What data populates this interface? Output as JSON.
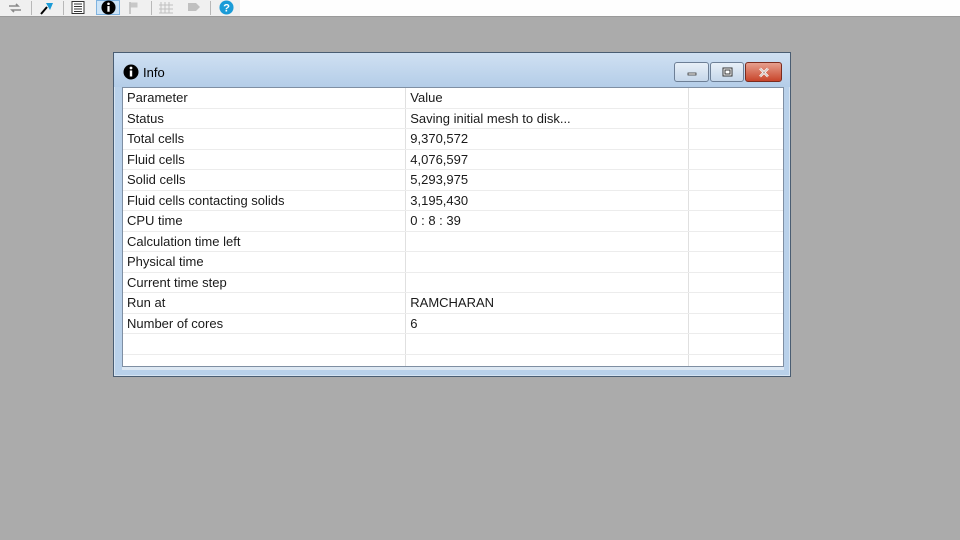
{
  "toolbar": {
    "icons": [
      "swap-arrows-icon",
      "pin-tool-icon",
      "list-icon",
      "info-icon",
      "flag-icon",
      "grid-icon",
      "shape-icon",
      "help-icon"
    ],
    "accent": "#1a9bd7"
  },
  "window": {
    "title": "Info",
    "title_icon": "info-icon",
    "controls": [
      "minimize-icon",
      "maximize-icon",
      "close-icon"
    ]
  },
  "table": {
    "headers": [
      "Parameter",
      "Value",
      ""
    ],
    "rows": [
      [
        "Status",
        "Saving initial mesh to disk..."
      ],
      [
        "Total cells",
        "9,370,572"
      ],
      [
        "Fluid cells",
        "4,076,597"
      ],
      [
        "Solid cells",
        "5,293,975"
      ],
      [
        "Fluid cells contacting solids",
        "3,195,430"
      ],
      [
        "CPU time",
        "0 : 8 : 39"
      ],
      [
        "Calculation time left",
        ""
      ],
      [
        "Physical time",
        ""
      ],
      [
        "Current time step",
        ""
      ],
      [
        "Run at",
        "RAMCHARAN"
      ],
      [
        "Number of cores",
        "6"
      ],
      [
        "",
        ""
      ],
      [
        "",
        ""
      ]
    ]
  },
  "colors": {
    "desktop": "#ababab",
    "window_frame": "#b9d1ea",
    "close_button": "#c8452b"
  }
}
